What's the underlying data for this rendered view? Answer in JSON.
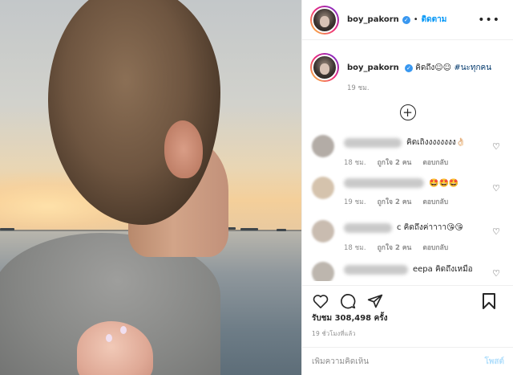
{
  "post": {
    "username": "boy_pakorn",
    "follow_label": "ติดตาม",
    "separator": "•",
    "caption_text": "คิดถึง☺︎☺︎",
    "caption_hashtag": "#นะทุกคน",
    "caption_time": "19 ชม.",
    "likes_text": "รับชม 308,498 ครั้ง",
    "time_ago": "19 ชั่วโมงที่แล้ว",
    "comment_placeholder": "เพิ่มความคิดเห็น",
    "post_label": "โพสต์"
  },
  "comments": [
    {
      "text": "คิดเถิงงงงงงงง👌🏻",
      "time": "18 ชม.",
      "likes": "ถูกใจ 2 คน",
      "reply": "ตอบกลับ"
    },
    {
      "text": "🤩🤩🤩",
      "time": "19 ชม.",
      "likes": "ถูกใจ 2 คน",
      "reply": "ตอบกลับ"
    },
    {
      "text": "c คิดถึงค่าาาา😘😘",
      "time": "18 ชม.",
      "likes": "ถูกใจ 2 คน",
      "reply": "ตอบกลับ"
    },
    {
      "text": "eepa คิดถึงเหมือ",
      "time": "",
      "likes": "",
      "reply": ""
    }
  ],
  "icons": {
    "more": "more-options-icon",
    "verified": "verified-badge-icon",
    "load_more": "plus-circle-icon",
    "like": "heart-icon",
    "comment": "comment-icon",
    "share": "paper-plane-icon",
    "save": "bookmark-icon"
  },
  "colors": {
    "link": "#0095f6",
    "verified": "#3897f0",
    "muted": "#8e8e8e"
  }
}
